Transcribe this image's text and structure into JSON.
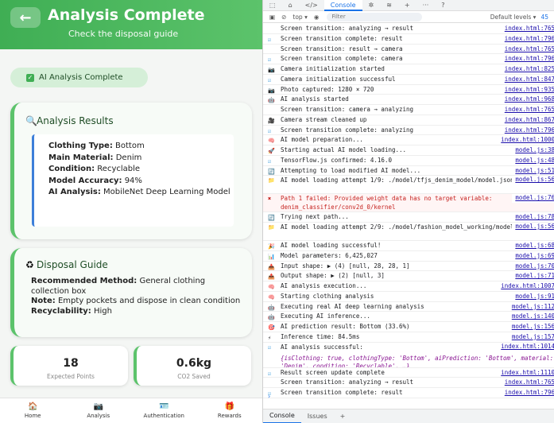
{
  "app": {
    "title": "Analysis Complete",
    "subtitle": "Check the disposal guide",
    "back_icon": "←",
    "status_pill": "AI Analysis Complete",
    "results": {
      "title": "Analysis Results",
      "rows": [
        {
          "label": "Clothing Type:",
          "value": "Bottom"
        },
        {
          "label": "Main Material:",
          "value": "Denim"
        },
        {
          "label": "Condition:",
          "value": "Recyclable"
        },
        {
          "label": "Model Accuracy:",
          "value": "94%"
        },
        {
          "label": "AI Analysis:",
          "value": "MobileNet Deep Learning Model"
        }
      ]
    },
    "guide": {
      "title": "Disposal Guide",
      "rows": [
        {
          "label": "Recommended Method:",
          "value": "General clothing collection box"
        },
        {
          "label": "Note:",
          "value": "Empty pockets and dispose in clean condition"
        },
        {
          "label": "Recyclability:",
          "value": "High"
        }
      ]
    },
    "stats": [
      {
        "value": "18",
        "label": "Expected Points"
      },
      {
        "value": "0.6kg",
        "label": "CO2 Saved"
      }
    ],
    "nav": [
      {
        "label": "Home",
        "icon": "house-icon"
      },
      {
        "label": "Analysis",
        "icon": "camera-icon"
      },
      {
        "label": "Authentication",
        "icon": "id-icon"
      },
      {
        "label": "Rewards",
        "icon": "gift-icon"
      }
    ],
    "colors": {
      "accent": "#4cb85e",
      "accent_light": "#d5efd8",
      "info": "#3d7fd9"
    }
  },
  "devtools": {
    "tabs": [
      "Console"
    ],
    "context": "top ▾",
    "filter_placeholder": "Filter",
    "levels": "Default levels ▾",
    "issues_count": "45",
    "bottom_tabs": [
      "Console",
      "Issues"
    ],
    "logs": [
      {
        "icon": "",
        "text": "Screen transition: analyzing → result",
        "src": "index.html:765"
      },
      {
        "icon": "check",
        "text": "Screen transition complete: result",
        "src": "index.html:796"
      },
      {
        "icon": "",
        "text": "Screen transition: result → camera",
        "src": "index.html:765"
      },
      {
        "icon": "check",
        "text": "Screen transition complete: camera",
        "src": "index.html:796"
      },
      {
        "icon": "camera",
        "text": "Camera initialization started",
        "src": "index.html:825"
      },
      {
        "icon": "check",
        "text": "Camera initialization successful",
        "src": "index.html:847"
      },
      {
        "icon": "camera",
        "text": "Photo captured: 1280 × 720",
        "src": "index.html:935"
      },
      {
        "icon": "robot",
        "text": "AI analysis started",
        "src": "index.html:968"
      },
      {
        "icon": "",
        "text": "Screen transition: camera → analyzing",
        "src": "index.html:765"
      },
      {
        "icon": "video",
        "text": "Camera stream cleaned up",
        "src": "index.html:867"
      },
      {
        "icon": "check",
        "text": "Screen transition complete: analyzing",
        "src": "index.html:796"
      },
      {
        "icon": "brain",
        "text": "AI model preparation...",
        "src": "index.html:1000"
      },
      {
        "icon": "rocket",
        "text": "Starting actual AI model loading...",
        "src": "model.js:38"
      },
      {
        "icon": "check",
        "text": "TensorFlow.js confirmed: 4.16.0",
        "src": "model.js:48"
      },
      {
        "icon": "refresh",
        "text": "Attempting to load modified AI model...",
        "src": "model.js:51"
      },
      {
        "icon": "folder",
        "text": "AI model loading attempt 1/9: ./model/tfjs_denim_model/model.json",
        "src": "model.js:56",
        "lines": 2
      },
      {
        "icon": "error",
        "text": "Path 1 failed: Provided weight data has no target variable: denim_classifier/conv2d_0/kernel",
        "src": "model.js:76",
        "lines": 2
      },
      {
        "icon": "refresh",
        "text": "Trying next path...",
        "src": "model.js:78"
      },
      {
        "icon": "folder",
        "text": "AI model loading attempt 2/9: ./model/fashion_model_working/model.json",
        "src": "model.js:56",
        "lines": 2
      },
      {
        "icon": "party",
        "text": "AI model loading successful!",
        "src": "model.js:68"
      },
      {
        "icon": "chart",
        "text": "Model parameters: 6,425,027",
        "src": "model.js:69"
      },
      {
        "icon": "input",
        "text": "Input shape:  ▶ (4) [null, 28, 28, 1]",
        "src": "model.js:70"
      },
      {
        "icon": "output",
        "text": "Output shape:  ▶ (2) [null, 3]",
        "src": "model.js:71"
      },
      {
        "icon": "brain",
        "text": "AI analysis execution...",
        "src": "index.html:1007"
      },
      {
        "icon": "brain",
        "text": "Starting clothing analysis",
        "src": "model.js:91"
      },
      {
        "icon": "robot",
        "text": "Executing real AI deep learning analysis",
        "src": "model.js:112"
      },
      {
        "icon": "robot",
        "text": "Executing AI inference...",
        "src": "model.js:140"
      },
      {
        "icon": "target",
        "text": "AI prediction result: Bottom (33.6%)",
        "src": "model.js:156"
      },
      {
        "icon": "bolt",
        "text": "Inference time: 84.5ms",
        "src": "model.js:157"
      },
      {
        "icon": "check",
        "text": "AI analysis successful:",
        "src": "index.html:1014",
        "detail": "{isClothing: true, clothingType: 'Bottom', aiPrediction: 'Bottom', material: 'Denim', condition: 'Recyclable', …}",
        "lines": 3
      },
      {
        "icon": "check",
        "text": "Result screen update complete",
        "src": "index.html:1110"
      },
      {
        "icon": "",
        "text": "Screen transition: analyzing → result",
        "src": "index.html:765"
      },
      {
        "icon": "check",
        "text": "Screen transition complete: result",
        "src": "index.html:796"
      }
    ]
  }
}
